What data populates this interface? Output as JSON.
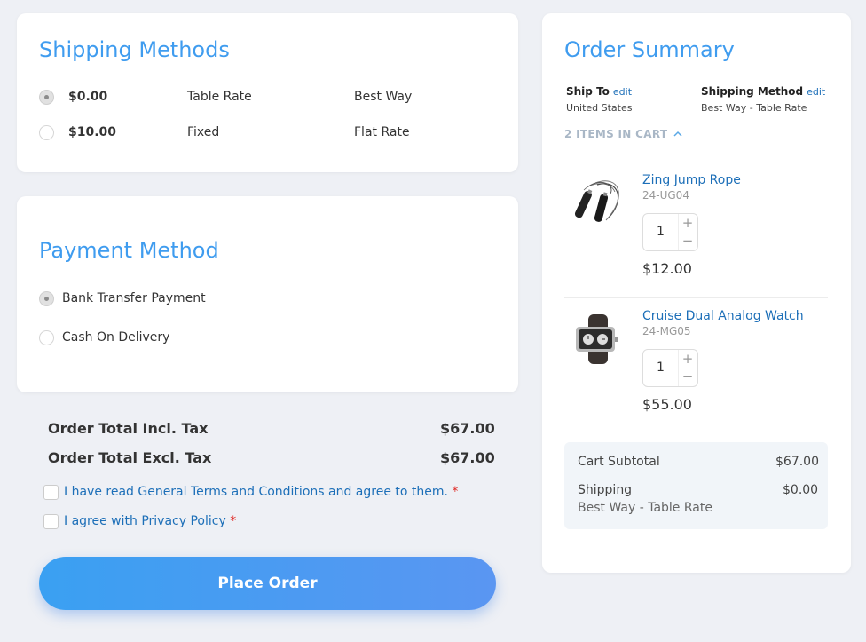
{
  "shipping": {
    "title": "Shipping Methods",
    "methods": [
      {
        "price": "$0.00",
        "method": "Table Rate",
        "carrier": "Best Way",
        "selected": true
      },
      {
        "price": "$10.00",
        "method": "Fixed",
        "carrier": "Flat Rate",
        "selected": false
      }
    ]
  },
  "payment": {
    "title": "Payment Method",
    "options": [
      {
        "label": "Bank Transfer Payment",
        "selected": true
      },
      {
        "label": "Cash On Delivery",
        "selected": false
      }
    ]
  },
  "totals": {
    "incl_label": "Order Total Incl. Tax",
    "incl_value": "$67.00",
    "excl_label": "Order Total Excl. Tax",
    "excl_value": "$67.00"
  },
  "agreements": {
    "terms": "I have read General Terms and Conditions and agree to them.",
    "privacy": "I agree with Privacy Policy",
    "required_mark": "*"
  },
  "place_order": "Place Order",
  "summary": {
    "title": "Order Summary",
    "ship_to_label": "Ship To",
    "ship_to_value": "United States",
    "ship_method_label": "Shipping Method",
    "ship_method_value": "Best Way - Table Rate",
    "edit_label": "edit",
    "items_in_cart": "2 ITEMS IN CART",
    "items": [
      {
        "name": "Zing Jump Rope",
        "sku": "24-UG04",
        "qty": "1",
        "price": "$12.00"
      },
      {
        "name": "Cruise Dual Analog Watch",
        "sku": "24-MG05",
        "qty": "1",
        "price": "$55.00"
      }
    ],
    "subtotal_label": "Cart Subtotal",
    "subtotal_value": "$67.00",
    "shipping_label": "Shipping",
    "shipping_value": "$0.00",
    "shipping_method": "Best Way - Table Rate"
  },
  "colors": {
    "accent": "#3f9cef",
    "link": "#1d6fb8",
    "required": "#e02b27",
    "background": "#eef0f5"
  }
}
